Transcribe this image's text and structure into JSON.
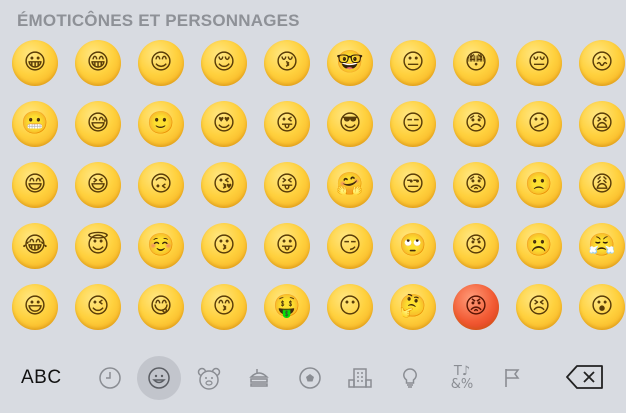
{
  "keyboard": {
    "section_title": "ÉMOTICÔNES ET PERSONNAGES",
    "emoji_grid": [
      [
        "😀",
        "😁",
        "😊",
        "😌",
        "😚",
        "🤓",
        "😐",
        "😳",
        "😔",
        "😖"
      ],
      [
        "😬",
        "😅",
        "🙂",
        "😍",
        "😜",
        "😎",
        "😑",
        "😞",
        "😕",
        "😫"
      ],
      [
        "😄",
        "😆",
        "🙃",
        "😘",
        "😝",
        "🤗",
        "😒",
        "😟",
        "🙁",
        "😩"
      ],
      [
        "😂",
        "😇",
        "☺️",
        "😗",
        "😛",
        "😏",
        "🙄",
        "😠",
        "☹️",
        "😤"
      ],
      [
        "😃",
        "😉",
        "😋",
        "😙",
        "🤑",
        "😶",
        "🤔",
        "😡",
        "😣",
        "😮"
      ]
    ],
    "bottom_bar": {
      "abc_label": "ABC",
      "categories": [
        {
          "icon": "clock-icon",
          "glyph": "🕘"
        },
        {
          "icon": "smiley-icon",
          "glyph": "☺"
        },
        {
          "icon": "bear-icon",
          "glyph": "🐻"
        },
        {
          "icon": "food-icon",
          "glyph": "🍔"
        },
        {
          "icon": "ball-icon",
          "glyph": "⚽"
        },
        {
          "icon": "building-icon",
          "glyph": "🏢"
        },
        {
          "icon": "lightbulb-icon",
          "glyph": "💡"
        },
        {
          "icon": "symbols-icon",
          "glyph_top": "T♪",
          "glyph_bottom": "&%"
        },
        {
          "icon": "flag-icon",
          "glyph": "⚐"
        }
      ],
      "active_category": "smiley-icon"
    }
  }
}
